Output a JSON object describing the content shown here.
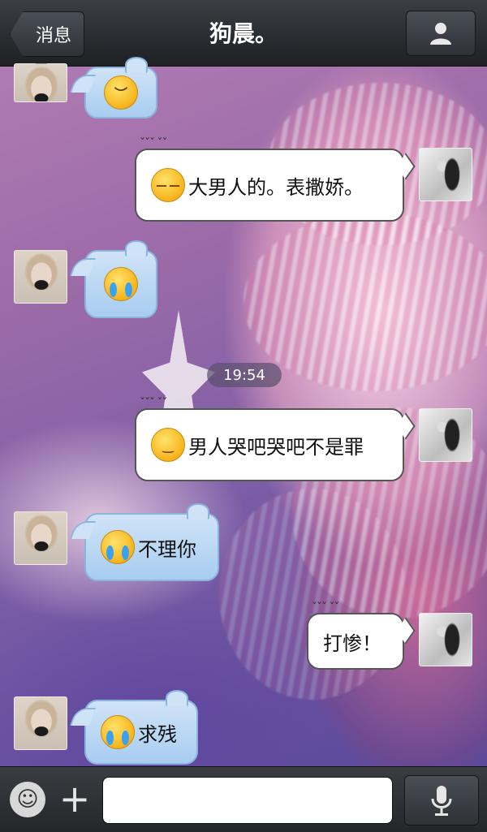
{
  "header": {
    "back_label": "消息",
    "title": "狗晨。"
  },
  "timestamp": "19:54",
  "messages": [
    {
      "side": "in",
      "emoji": "sad-face-emoji",
      "text": ""
    },
    {
      "side": "out",
      "emoji": "unamused-face-emoji",
      "text": "大男人的。表撒娇。"
    },
    {
      "side": "in",
      "emoji": "crying-face-emoji",
      "text": ""
    },
    {
      "side": "out",
      "emoji": "smirk-face-emoji",
      "text": "男人哭吧哭吧不是罪"
    },
    {
      "side": "in",
      "emoji": "loudly-crying-face-emoji",
      "text": "不理你"
    },
    {
      "side": "out",
      "emoji": "",
      "text": "打惨！"
    },
    {
      "side": "in",
      "emoji": "loudly-crying-face-emoji",
      "text": "求残"
    }
  ],
  "input": {
    "value": ""
  },
  "colors": {
    "incoming_bubble": "#a8cdf0",
    "outgoing_bubble": "#ffffff",
    "header_bg": "#2a2d31"
  }
}
